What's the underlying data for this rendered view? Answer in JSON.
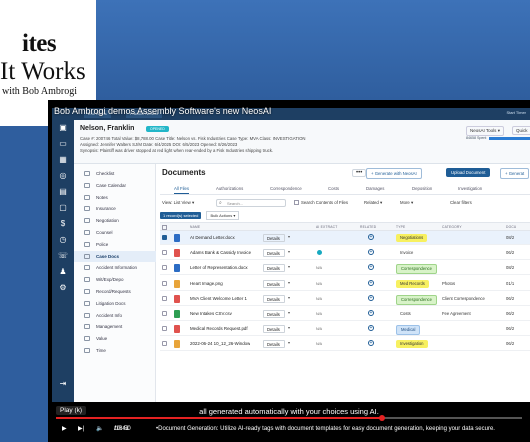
{
  "background": {
    "book_title_line1": "ites",
    "book_title_line2": "It Works",
    "book_title_line3": "with Bob Ambrogi"
  },
  "video": {
    "title": "Bob Ambrogi demos Assembly Software's new NeosAI",
    "caption": "all generated automatically with your choices using AI.",
    "tooltip": "Play (k)",
    "time_current": "10:41",
    "time_total": "16:50",
    "chapter": "Document Generation: Utilize AI-ready tags with document templates for easy document generation, keeping your data secure.",
    "progress_fraction": 0.7
  },
  "app": {
    "top_tabs": [
      "Eric Norris",
      "Franklin Nelson"
    ],
    "top_right": "Start Timer",
    "case": {
      "name": "Nelson, Franklin",
      "badge": "OPENED",
      "meta_line1": "Case #: 200746   Total Value: $8,788.00   Case Title: Nelson vs. Fisk Industries   Case Type: MVA   Class: INVESTIGATION",
      "meta_line2": "Assigned: Jennifer Walters   SJ/M Date: 6/4/2025   DOI: 6/5/2023   Opened: 8/26/2023",
      "meta_line3": "Synopsis: Plaintiff was driver stopped at red light when rear-ended by a Fisk Industries shipping truck.",
      "neosai_tools": "NeosAI Tools",
      "quick": "Quick",
      "progress_label": "84658 Spent",
      "progress_fraction": 0.85
    },
    "sidebar": [
      {
        "label": "Checklist"
      },
      {
        "label": "Case Calendar"
      },
      {
        "label": "Notes"
      },
      {
        "label": "Insurance"
      },
      {
        "label": "Negotiation"
      },
      {
        "label": "Counsel"
      },
      {
        "label": "Police"
      },
      {
        "label": "Case Docs",
        "active": true
      },
      {
        "label": "Accident Information"
      },
      {
        "label": "Wit/Exp/Depo"
      },
      {
        "label": "Record/Requests"
      },
      {
        "label": "Litigation Docs"
      },
      {
        "label": "Accident Info"
      },
      {
        "label": "Management"
      },
      {
        "label": "Value"
      },
      {
        "label": "Time"
      }
    ],
    "documents": {
      "title": "Documents",
      "dots": "•••",
      "generate_neosai": "+ Generate with NeosAI",
      "upload": "Upload Document",
      "generate": "+ Generat",
      "tabs": [
        "All Files",
        "Authorizations",
        "Correspondence",
        "Costs",
        "Damages",
        "Deposition",
        "Investigation"
      ],
      "view_label": "View: List View",
      "search_placeholder": "Search...",
      "search_contents": "Search Contents of Files",
      "related": "Related",
      "more": "More",
      "clear_filters": "Clear filters",
      "selected": "1 record(s) selected",
      "bulk_actions": "Bulk Actions",
      "columns": [
        "NAME",
        "AI EXTRACT",
        "RELATED",
        "TYPE",
        "CATEGORY",
        "DOCU"
      ],
      "rows": [
        {
          "name": "AI Demand Letter.docx",
          "sub": "AI Generated",
          "ai": "",
          "tag": "Negotiations",
          "tag_style": "yellow",
          "category": "",
          "date": "08/2",
          "selected": true,
          "icon_color": "#2b6cc4"
        },
        {
          "name": "Adams Bank & Cassidy Invoice",
          "ai": "dot",
          "tag": "Invoice",
          "tag_style": "plain",
          "category": "",
          "date": "06/2",
          "icon_color": "#e0524e"
        },
        {
          "name": "Letter of Representation.docx",
          "ai": "N/A",
          "tag": "Correspondence",
          "tag_style": "green",
          "category": "",
          "date": "08/2",
          "icon_color": "#2b6cc4"
        },
        {
          "name": "Heart Image.png",
          "ai": "N/A",
          "tag": "Med Records",
          "tag_style": "yellow",
          "category": "Photos",
          "date": "01/1",
          "icon_color": "#e8a43a"
        },
        {
          "name": "MVA Client Welcome Letter 1",
          "ai": "N/A",
          "tag": "Correspondence",
          "tag_style": "green",
          "category": "Client Correspondence",
          "date": "06/2",
          "icon_color": "#e0524e"
        },
        {
          "name": "New Intakes CSV.csv",
          "ai": "N/A",
          "tag": "Costs",
          "tag_style": "plain",
          "category": "Fee Agreement",
          "date": "06/2",
          "icon_color": "#2e9e52"
        },
        {
          "name": "Medical Records Request.pdf",
          "ai": "N/A",
          "tag": "Medical",
          "tag_style": "blue",
          "category": "",
          "date": "06/2",
          "icon_color": "#e0524e"
        },
        {
          "name": "2022-06-24 10_12_26-Window",
          "ai": "N/A",
          "tag": "Investigation",
          "tag_style": "yellow",
          "category": "",
          "date": "06/2",
          "icon_color": "#e8a43a"
        }
      ]
    }
  }
}
